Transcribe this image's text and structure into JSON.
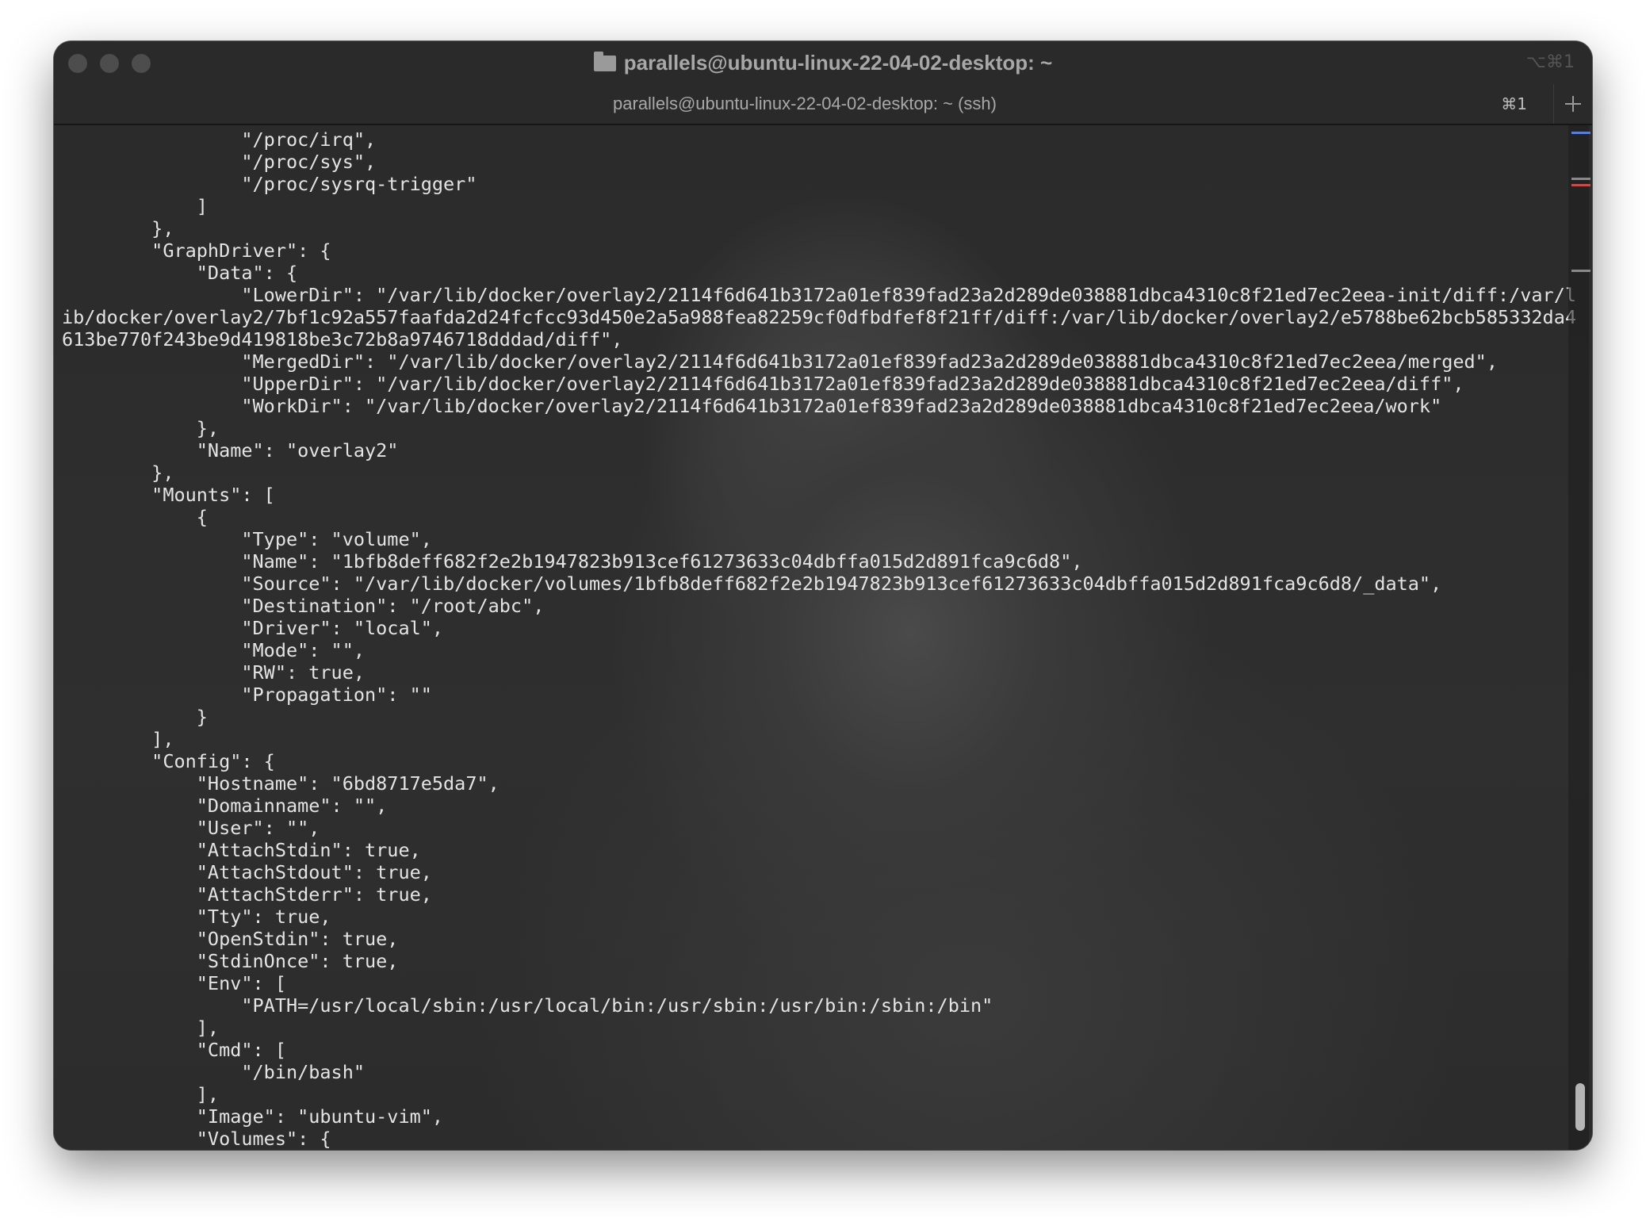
{
  "window": {
    "title": "parallels@ubuntu-linux-22-04-02-desktop: ~",
    "title_shortcut": "⌥⌘1",
    "folder_icon": "folder-icon"
  },
  "tab": {
    "label": "parallels@ubuntu-linux-22-04-02-desktop: ~ (ssh)",
    "shortcut": "⌘1",
    "new_tab_icon": "plus-icon"
  },
  "terminal": {
    "lines": [
      "                \"/proc/irq\",",
      "                \"/proc/sys\",",
      "                \"/proc/sysrq-trigger\"",
      "            ]",
      "        },",
      "        \"GraphDriver\": {",
      "            \"Data\": {",
      "                \"LowerDir\": \"/var/lib/docker/overlay2/2114f6d641b3172a01ef839fad23a2d289de038881dbca4310c8f21ed7ec2eea-init/diff:/var/l",
      "ib/docker/overlay2/7bf1c92a557faafda2d24fcfcc93d450e2a5a988fea82259cf0dfbdfef8f21ff/diff:/var/lib/docker/overlay2/e5788be62bcb585332da4",
      "613be770f243be9d419818be3c72b8a9746718dddad/diff\",",
      "                \"MergedDir\": \"/var/lib/docker/overlay2/2114f6d641b3172a01ef839fad23a2d289de038881dbca4310c8f21ed7ec2eea/merged\",",
      "                \"UpperDir\": \"/var/lib/docker/overlay2/2114f6d641b3172a01ef839fad23a2d289de038881dbca4310c8f21ed7ec2eea/diff\",",
      "                \"WorkDir\": \"/var/lib/docker/overlay2/2114f6d641b3172a01ef839fad23a2d289de038881dbca4310c8f21ed7ec2eea/work\"",
      "            },",
      "            \"Name\": \"overlay2\"",
      "        },",
      "        \"Mounts\": [",
      "            {",
      "                \"Type\": \"volume\",",
      "                \"Name\": \"1bfb8deff682f2e2b1947823b913cef61273633c04dbffa015d2d891fca9c6d8\",",
      "                \"Source\": \"/var/lib/docker/volumes/1bfb8deff682f2e2b1947823b913cef61273633c04dbffa015d2d891fca9c6d8/_data\",",
      "                \"Destination\": \"/root/abc\",",
      "                \"Driver\": \"local\",",
      "                \"Mode\": \"\",",
      "                \"RW\": true,",
      "                \"Propagation\": \"\"",
      "            }",
      "        ],",
      "        \"Config\": {",
      "            \"Hostname\": \"6bd8717e5da7\",",
      "            \"Domainname\": \"\",",
      "            \"User\": \"\",",
      "            \"AttachStdin\": true,",
      "            \"AttachStdout\": true,",
      "            \"AttachStderr\": true,",
      "            \"Tty\": true,",
      "            \"OpenStdin\": true,",
      "            \"StdinOnce\": true,",
      "            \"Env\": [",
      "                \"PATH=/usr/local/sbin:/usr/local/bin:/usr/sbin:/usr/bin:/sbin:/bin\"",
      "            ],",
      "            \"Cmd\": [",
      "                \"/bin/bash\"",
      "            ],",
      "            \"Image\": \"ubuntu-vim\",",
      "            \"Volumes\": {"
    ]
  },
  "scrollbar": {
    "marks": [
      {
        "color": "#5b7fd6"
      },
      {
        "color": "#8a8a8a"
      },
      {
        "color": "#c0504d"
      },
      {
        "color": "#8a8a8a"
      }
    ],
    "position_fraction": 0.96
  },
  "colors": {
    "text": "#e4e4e4",
    "window_bg": "#262626",
    "titlebar_bg": "#2a2a2a"
  }
}
